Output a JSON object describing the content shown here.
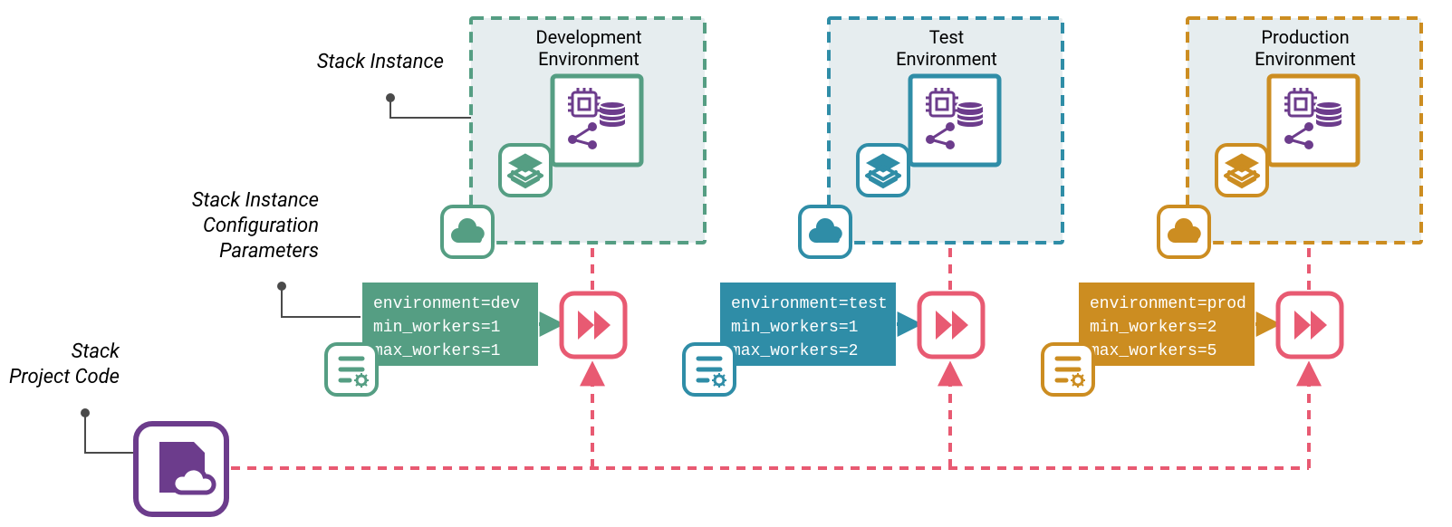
{
  "labels": {
    "stack_instance": "Stack Instance",
    "stack_instance_config_l1": "Stack Instance",
    "stack_instance_config_l2": "Configuration",
    "stack_instance_config_l3": "Parameters",
    "stack_project_code_l1": "Stack",
    "stack_project_code_l2": "Project Code"
  },
  "environments": [
    {
      "name": "dev",
      "title_l1": "Development",
      "title_l2": "Environment",
      "config_l1": "environment=dev",
      "config_l2": "min_workers=1",
      "config_l3": "max_workers=1",
      "colors": {
        "primary": "#559e83",
        "accent": "#6c3c8c"
      }
    },
    {
      "name": "test",
      "title_l1": "Test",
      "title_l2": "Environment",
      "config_l1": "environment=test",
      "config_l2": "min_workers=1",
      "config_l3": "max_workers=2",
      "colors": {
        "primary": "#2f8da7",
        "accent": "#6c3c8c"
      }
    },
    {
      "name": "prod",
      "title_l1": "Production",
      "title_l2": "Environment",
      "config_l1": "environment=prod",
      "config_l2": "min_workers=2",
      "config_l3": "max_workers=5",
      "colors": {
        "primary": "#cc8d21",
        "accent": "#6c3c8c"
      }
    }
  ],
  "colors": {
    "green": "#559e83",
    "teal": "#2f8da7",
    "gold": "#cc8d21",
    "purple": "#6c3c8c",
    "pink": "#e85a72",
    "envbg": "#e6edef",
    "grey": "#4a4a4a"
  }
}
